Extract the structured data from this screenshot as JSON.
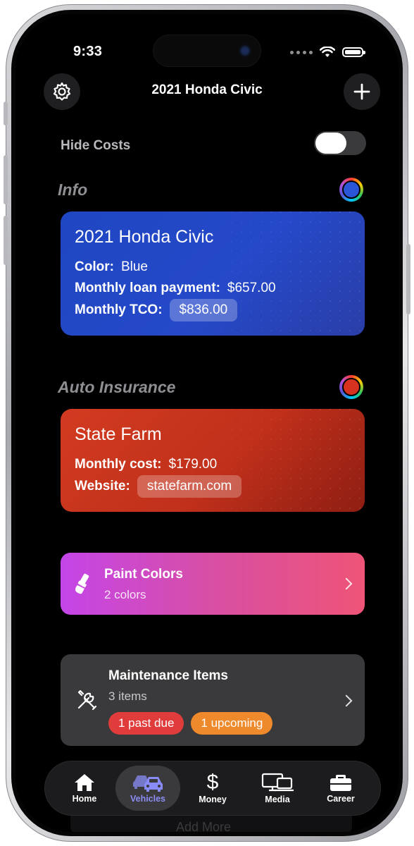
{
  "status_bar": {
    "time": "9:33"
  },
  "nav": {
    "title": "2021 Honda Civic"
  },
  "hide_costs": {
    "label": "Hide Costs",
    "enabled": false
  },
  "info": {
    "section_title": "Info",
    "card_title": "2021 Honda Civic",
    "color_label": "Color:",
    "color_value": "Blue",
    "loan_label": "Monthly loan payment:",
    "loan_value": "$657.00",
    "tco_label": "Monthly TCO:",
    "tco_value": "$836.00",
    "card_color": "#2046c8"
  },
  "insurance": {
    "section_title": "Auto Insurance",
    "card_title": "State Farm",
    "cost_label": "Monthly cost:",
    "cost_value": "$179.00",
    "website_label": "Website:",
    "website_value": "statefarm.com",
    "card_color": "#c9321e"
  },
  "paint_colors": {
    "title": "Paint Colors",
    "subtitle": "2 colors",
    "icon": "paintbrush-icon"
  },
  "maintenance": {
    "title": "Maintenance Items",
    "subtitle": "3 items",
    "icon": "wrench-screwdriver-icon",
    "badges": [
      {
        "label": "1 past due",
        "color": "#e03c3c"
      },
      {
        "label": "1 upcoming",
        "color": "#ef8a2c"
      }
    ]
  },
  "ghost_text": "Add More",
  "tabs": [
    {
      "label": "Home",
      "icon": "house-icon",
      "active": false
    },
    {
      "label": "Vehicles",
      "icon": "cars-icon",
      "active": true
    },
    {
      "label": "Money",
      "icon": "dollar-icon",
      "active": false
    },
    {
      "label": "Media",
      "icon": "devices-icon",
      "active": false
    },
    {
      "label": "Career",
      "icon": "briefcase-icon",
      "active": false
    }
  ]
}
